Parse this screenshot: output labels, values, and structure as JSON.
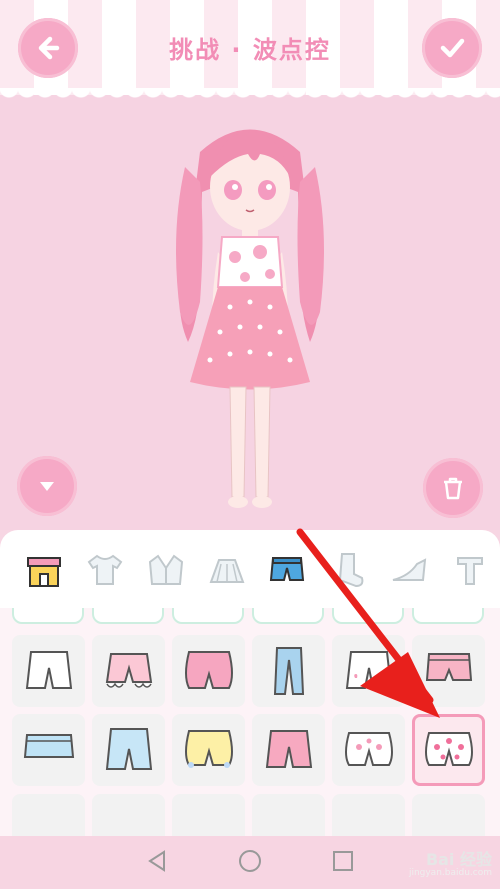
{
  "header": {
    "title": "挑战 · 波点控"
  },
  "icons": {
    "back": "arrow-left-icon",
    "confirm": "checkmark-icon",
    "collapse": "chevron-down-icon",
    "delete": "trash-icon"
  },
  "categories": [
    {
      "name": "shop",
      "icon": "shop-icon",
      "active": false
    },
    {
      "name": "tops",
      "icon": "tshirt-icon",
      "active": false
    },
    {
      "name": "jackets",
      "icon": "jacket-icon",
      "active": false
    },
    {
      "name": "skirts",
      "icon": "skirt-icon",
      "active": false
    },
    {
      "name": "shorts",
      "icon": "shorts-icon",
      "active": true
    },
    {
      "name": "socks",
      "icon": "sock-icon",
      "active": false
    },
    {
      "name": "shoes",
      "icon": "shoe-icon",
      "active": false
    },
    {
      "name": "more",
      "icon": "tshirt-icon",
      "active": false
    }
  ],
  "items": {
    "row1": [
      "white shorts",
      "pink ruffle shorts",
      "pink bloomers",
      "blue jeans",
      "white heart shorts",
      "pink pocket shorts"
    ],
    "row2": [
      "denim skirt shorts",
      "light blue shorts",
      "yellow bow bloomers",
      "pink shorts",
      "white polka bloomers",
      "pink polka bloomers"
    ],
    "selected_index": 11
  },
  "colors": {
    "accent": "#f6a9c6",
    "title": "#f28db6",
    "arrow": "#e8201c"
  },
  "navbar": [
    "back-triangle-icon",
    "home-circle-icon",
    "recents-square-icon"
  ],
  "watermark": {
    "brand": "Bai 经验",
    "url": "jingyan.baidu.com"
  }
}
